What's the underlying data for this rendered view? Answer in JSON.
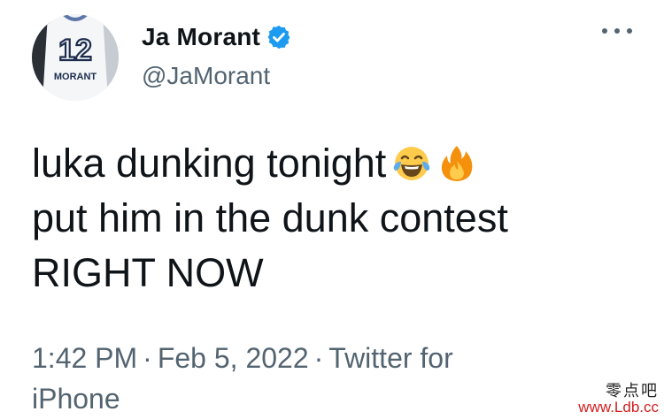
{
  "author": {
    "display_name": "Ja Morant",
    "handle": "@JaMorant",
    "avatar": {
      "jersey_number": "12",
      "jersey_name": "MORANT"
    }
  },
  "tweet": {
    "lines": [
      "luka dunking tonight",
      "put him in the dunk contest",
      "RIGHT NOW"
    ],
    "emojis": [
      "face-with-tears-of-joy-icon",
      "fire-icon"
    ]
  },
  "meta": {
    "time": "1:42 PM",
    "separator": "·",
    "date": "Feb 5, 2022",
    "source_line1": "Twitter for",
    "source_line2": "iPhone"
  },
  "watermark": {
    "chinese": "零点吧",
    "url": "www.Ldb.cc"
  },
  "colors": {
    "verified_blue": "#1d9bf0",
    "secondary_text": "#536471",
    "primary_text": "#0f1419",
    "watermark_red": "#d21f1f"
  }
}
